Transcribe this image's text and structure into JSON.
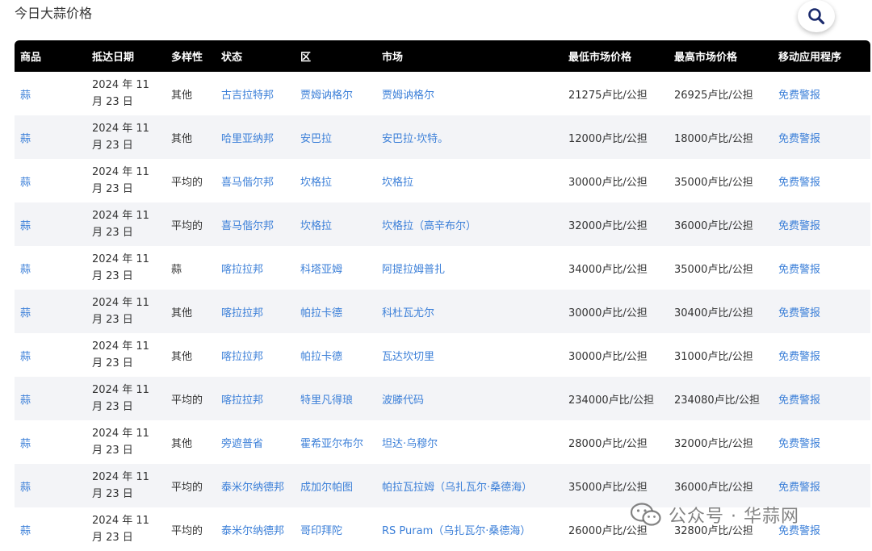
{
  "header": {
    "title": "今日大蒜价格"
  },
  "icons": {
    "search": "search-icon"
  },
  "colors": {
    "header_bg": "#000000",
    "link": "#3b7fd8",
    "stripe": "#f3f4f7"
  },
  "table": {
    "columns": [
      "商品",
      "抵达日期",
      "多样性",
      "状态",
      "区",
      "市场",
      "最低市场价格",
      "最高市场价格",
      "移动应用程序"
    ],
    "rows": [
      {
        "commodity": "蒜",
        "date": "2024 年 11 月 23 日",
        "variety": "其他",
        "state": "古吉拉特邦",
        "district": "贾姆讷格尔",
        "market": "贾姆讷格尔",
        "min": "21275卢比/公担",
        "max": "26925卢比/公担",
        "app": "免费警报"
      },
      {
        "commodity": "蒜",
        "date": "2024 年 11 月 23 日",
        "variety": "其他",
        "state": "哈里亚纳邦",
        "district": "安巴拉",
        "market": "安巴拉·坎特。",
        "min": "12000卢比/公担",
        "max": "18000卢比/公担",
        "app": "免费警报"
      },
      {
        "commodity": "蒜",
        "date": "2024 年 11 月 23 日",
        "variety": "平均的",
        "state": "喜马偕尔邦",
        "district": "坎格拉",
        "market": "坎格拉",
        "min": "30000卢比/公担",
        "max": "35000卢比/公担",
        "app": "免费警报"
      },
      {
        "commodity": "蒜",
        "date": "2024 年 11 月 23 日",
        "variety": "平均的",
        "state": "喜马偕尔邦",
        "district": "坎格拉",
        "market": "坎格拉（高辛布尔）",
        "min": "32000卢比/公担",
        "max": "36000卢比/公担",
        "app": "免费警报"
      },
      {
        "commodity": "蒜",
        "date": "2024 年 11 月 23 日",
        "variety": "蒜",
        "state": "喀拉拉邦",
        "district": "科塔亚姆",
        "market": "阿提拉姆普扎",
        "min": "34000卢比/公担",
        "max": "35000卢比/公担",
        "app": "免费警报"
      },
      {
        "commodity": "蒜",
        "date": "2024 年 11 月 23 日",
        "variety": "其他",
        "state": "喀拉拉邦",
        "district": "帕拉卡德",
        "market": "科杜瓦尤尔",
        "min": "30000卢比/公担",
        "max": "30400卢比/公担",
        "app": "免费警报"
      },
      {
        "commodity": "蒜",
        "date": "2024 年 11 月 23 日",
        "variety": "其他",
        "state": "喀拉拉邦",
        "district": "帕拉卡德",
        "market": "瓦达坎切里",
        "min": "30000卢比/公担",
        "max": "31000卢比/公担",
        "app": "免费警报"
      },
      {
        "commodity": "蒜",
        "date": "2024 年 11 月 23 日",
        "variety": "平均的",
        "state": "喀拉拉邦",
        "district": "特里凡得琅",
        "market": "波滕代码",
        "min": "234000卢比/公担",
        "max": "234080卢比/公担",
        "app": "免费警报"
      },
      {
        "commodity": "蒜",
        "date": "2024 年 11 月 23 日",
        "variety": "其他",
        "state": "旁遮普省",
        "district": "霍希亚尔布尔",
        "market": "坦达·乌穆尔",
        "min": "28000卢比/公担",
        "max": "32000卢比/公担",
        "app": "免费警报"
      },
      {
        "commodity": "蒜",
        "date": "2024 年 11 月 23 日",
        "variety": "平均的",
        "state": "泰米尔纳德邦",
        "district": "成加尔帕图",
        "market": "帕拉瓦拉姆（乌扎瓦尔·桑德海）",
        "min": "35000卢比/公担",
        "max": "36000卢比/公担",
        "app": "免费警报"
      },
      {
        "commodity": "蒜",
        "date": "2024 年 11 月 23 日",
        "variety": "平均的",
        "state": "泰米尔纳德邦",
        "district": "哥印拜陀",
        "market": "RS Puram（乌扎瓦尔·桑德海）",
        "min": "26000卢比/公担",
        "max": "32800卢比/公担",
        "app": "免费警报"
      }
    ]
  },
  "watermark": {
    "text": "公众号 · 华蒜网"
  }
}
